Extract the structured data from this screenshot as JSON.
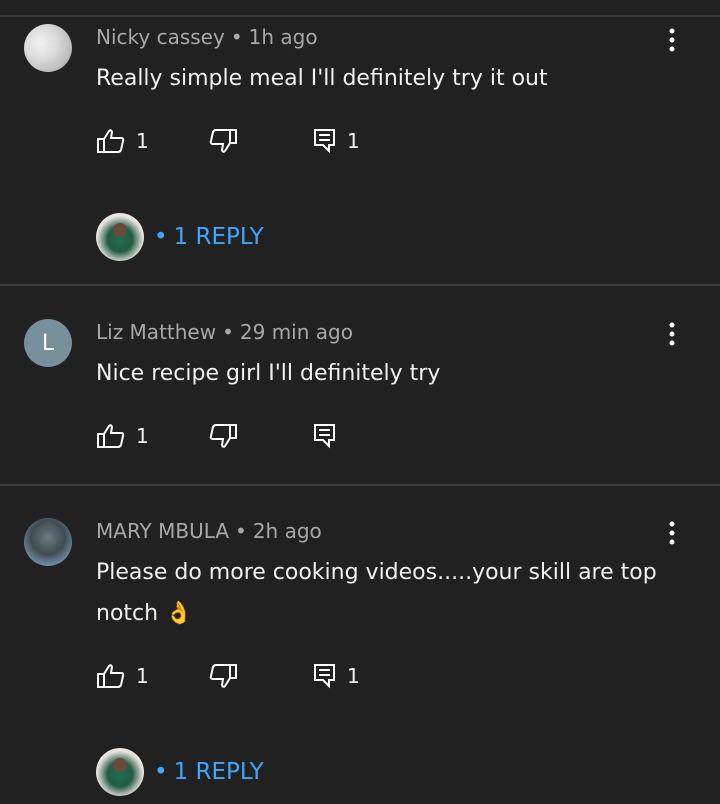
{
  "comments": [
    {
      "author": "Nicky cassey",
      "time": "1h ago",
      "text": "Really simple meal I'll definitely try it out",
      "like_count": "1",
      "reply_count": "1",
      "reply_label": "1 REPLY"
    },
    {
      "author": "Liz Matthew",
      "time": "29 min ago",
      "text": "Nice recipe girl I'll definitely  try",
      "avatar_letter": "L",
      "like_count": "1"
    },
    {
      "author": "MARY MBULA",
      "time": "2h ago",
      "text": "Please do more cooking videos.....your skill are top notch 👌",
      "like_count": "1",
      "reply_count": "1",
      "reply_label": "1 REPLY"
    }
  ],
  "separator": "•",
  "colors": {
    "background": "#212121",
    "accent_link": "#3ea6ff",
    "divider": "#3a3a3a",
    "meta_text": "#a8a8a8"
  },
  "icons": [
    "more-vertical-icon",
    "thumbs-up-icon",
    "thumbs-down-icon",
    "reply-comment-icon"
  ]
}
